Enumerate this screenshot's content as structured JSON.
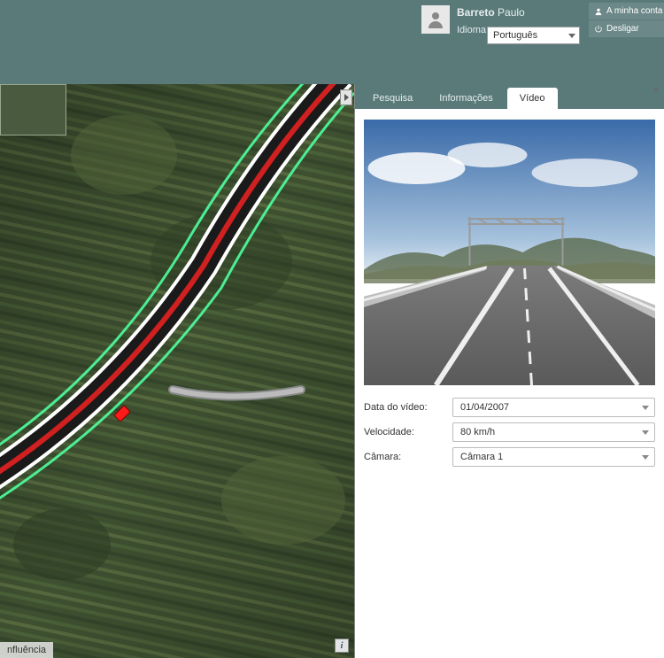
{
  "header": {
    "user_lastname": "Barreto",
    "user_firstname": "Paulo",
    "language_label": "Idioma:",
    "language_value": "Português",
    "account_label": "A minha conta",
    "logout_label": "Desligar"
  },
  "map": {
    "bottom_tab": "nfluência",
    "info_button": "i"
  },
  "tabs": [
    {
      "label": "Pesquisa",
      "active": false
    },
    {
      "label": "Informações",
      "active": false
    },
    {
      "label": "Vídeo",
      "active": true
    }
  ],
  "video_form": {
    "rows": [
      {
        "label": "Data do vídeo:",
        "value": "01/04/2007"
      },
      {
        "label": "Velocidade:",
        "value": "80 km/h"
      },
      {
        "label": "Câmara:",
        "value": "Câmara 1"
      }
    ]
  }
}
